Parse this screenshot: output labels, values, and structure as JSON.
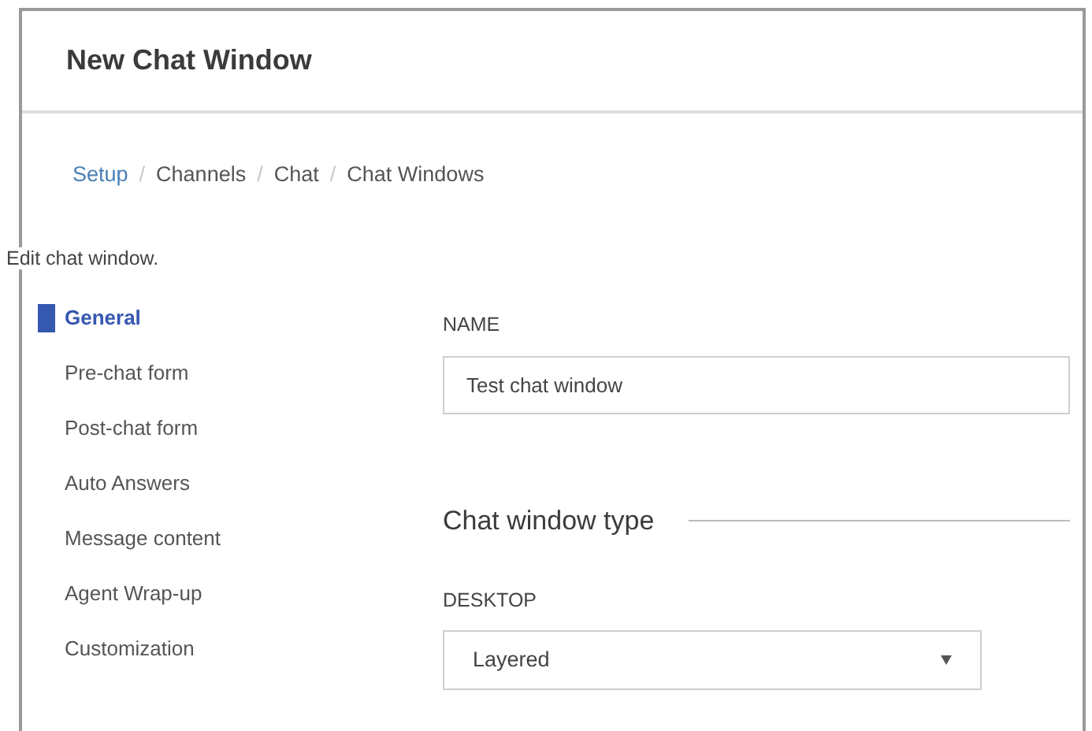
{
  "title": "New Chat Window",
  "breadcrumb": [
    {
      "label": "Setup",
      "link": true
    },
    {
      "label": "/",
      "link": false
    },
    {
      "label": "Channels",
      "link": false
    },
    {
      "label": "/",
      "link": false
    },
    {
      "label": "Chat",
      "link": false
    },
    {
      "label": "/",
      "link": false
    },
    {
      "label": "Chat Windows",
      "link": false
    }
  ],
  "description": "Edit chat window.",
  "sidebar": {
    "items": [
      {
        "label": "General",
        "selected": true
      },
      {
        "label": "Pre-chat form",
        "selected": false
      },
      {
        "label": "Post-chat form",
        "selected": false
      },
      {
        "label": "Auto Answers",
        "selected": false
      },
      {
        "label": "Message content",
        "selected": false
      },
      {
        "label": "Agent Wrap-up",
        "selected": false
      },
      {
        "label": "Customization",
        "selected": false
      }
    ]
  },
  "name_field": {
    "label": "NAME",
    "value": "Test chat window"
  },
  "section_title": "Chat window type",
  "desktop_select": {
    "label": "DESKTOP",
    "value": "Layered"
  }
}
